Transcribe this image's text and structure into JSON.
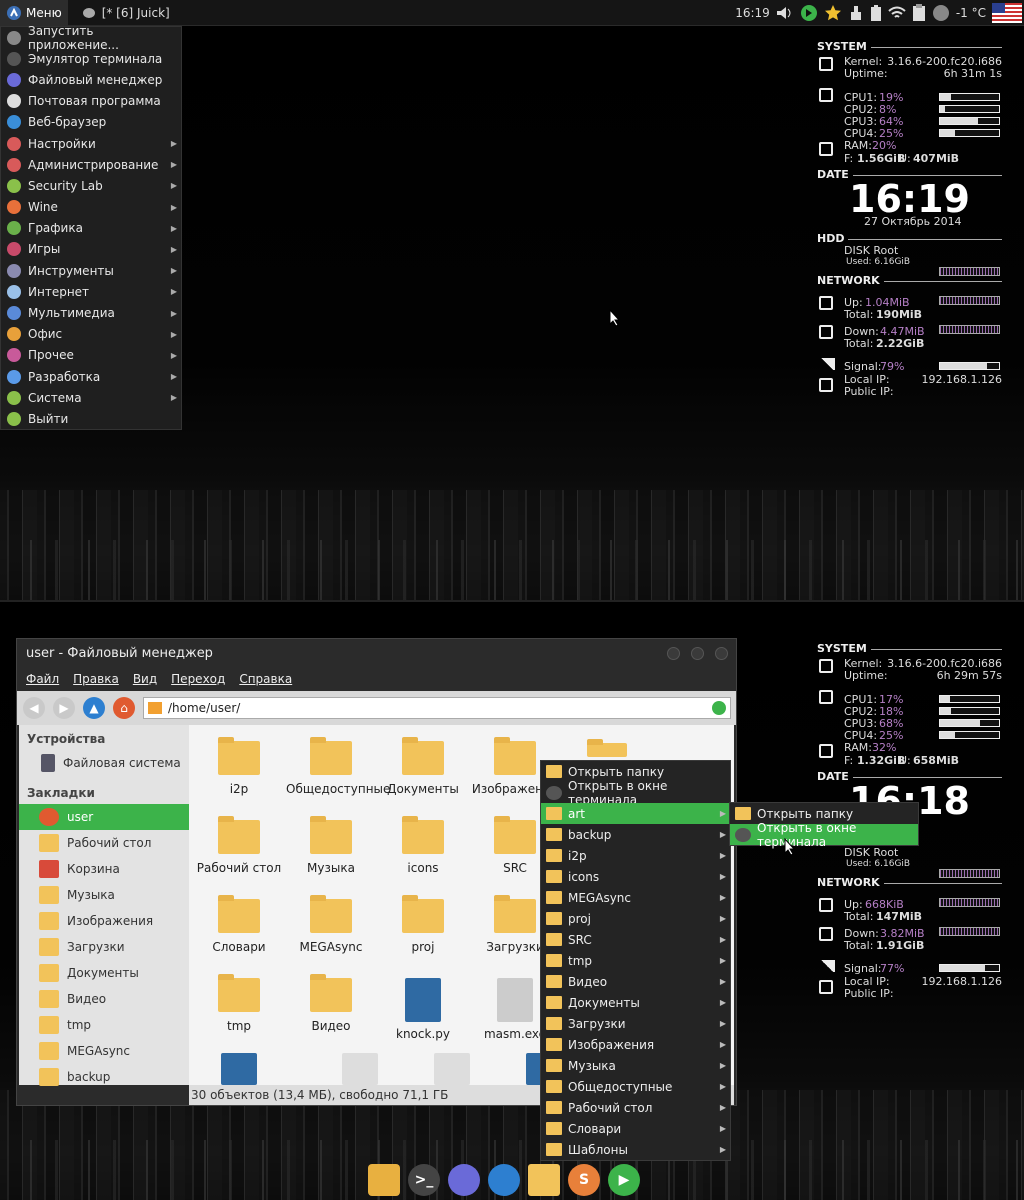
{
  "top_panel": {
    "menu_label": "Меню",
    "taskbar_item": "[* [6] Juick]",
    "clock": "16:19",
    "weather": "-1 °C"
  },
  "app_menu": {
    "items": [
      {
        "label": "Запустить приложение...",
        "submenu": false,
        "color": "#888888"
      },
      {
        "label": "Эмулятор терминала",
        "submenu": false,
        "color": "#555555"
      },
      {
        "label": "Файловый менеджер",
        "submenu": false,
        "color": "#6a6ad8"
      },
      {
        "label": "Почтовая программа",
        "submenu": false,
        "color": "#dddddd"
      },
      {
        "label": "Веб-браузер",
        "submenu": false,
        "color": "#3a8ed8"
      },
      {
        "label": "Настройки",
        "submenu": true,
        "color": "#d85a5a"
      },
      {
        "label": "Администрирование",
        "submenu": true,
        "color": "#d85a5a"
      },
      {
        "label": "Security Lab",
        "submenu": true,
        "color": "#8ac04a"
      },
      {
        "label": "Wine",
        "submenu": true,
        "color": "#e8703a"
      },
      {
        "label": "Графика",
        "submenu": true,
        "color": "#6ab04a"
      },
      {
        "label": "Игры",
        "submenu": true,
        "color": "#c84a6a"
      },
      {
        "label": "Инструменты",
        "submenu": true,
        "color": "#8a8ab0"
      },
      {
        "label": "Интернет",
        "submenu": true,
        "color": "#9ac0e8"
      },
      {
        "label": "Мультимедиа",
        "submenu": true,
        "color": "#5a8ad8"
      },
      {
        "label": "Офис",
        "submenu": true,
        "color": "#e8a03a"
      },
      {
        "label": "Прочее",
        "submenu": true,
        "color": "#c85a9a"
      },
      {
        "label": "Разработка",
        "submenu": true,
        "color": "#5a9ae8"
      },
      {
        "label": "Система",
        "submenu": true,
        "color": "#8ac04a"
      },
      {
        "label": "Выйти",
        "submenu": false,
        "color": "#8ac04a"
      }
    ]
  },
  "conky_top": {
    "system_header": "SYSTEM",
    "kernel_label": "Kernel:",
    "kernel": "3.16.6-200.fc20.i686",
    "uptime_label": "Uptime:",
    "uptime": "6h 31m 1s",
    "cpus": [
      {
        "label": "CPU1:",
        "value": "19%",
        "fraction": 0.19
      },
      {
        "label": "CPU2:",
        "value": "8%",
        "fraction": 0.08
      },
      {
        "label": "CPU3:",
        "value": "64%",
        "fraction": 0.64
      },
      {
        "label": "CPU4:",
        "value": "25%",
        "fraction": 0.25
      }
    ],
    "ram_label": "RAM:",
    "ram": "20%",
    "free_label": "F:",
    "free": "1.56GiB",
    "used_label": "U:",
    "used": "407MiB",
    "date_header": "DATE",
    "time": "16:19",
    "date": "27 Октябрь 2014",
    "hdd_header": "HDD",
    "disk_label": "DISK Root",
    "disk_used": "Used: 6.16GiB",
    "network_header": "NETWORK",
    "up_label": "Up:",
    "up": "1.04MiB",
    "up_total_label": "Total:",
    "up_total": "190MiB",
    "down_label": "Down:",
    "down": "4.47MiB",
    "down_total_label": "Total:",
    "down_total": "2.22GiB",
    "signal_label": "Signal:",
    "signal": "79%",
    "signal_fraction": 0.79,
    "local_ip_label": "Local IP:",
    "local_ip": "192.168.1.126",
    "public_ip_label": "Public IP:"
  },
  "conky_bottom": {
    "system_header": "SYSTEM",
    "kernel_label": "Kernel:",
    "kernel": "3.16.6-200.fc20.i686",
    "uptime_label": "Uptime:",
    "uptime": "6h 29m 57s",
    "cpus": [
      {
        "label": "CPU1:",
        "value": "17%",
        "fraction": 0.17
      },
      {
        "label": "CPU2:",
        "value": "18%",
        "fraction": 0.18
      },
      {
        "label": "CPU3:",
        "value": "68%",
        "fraction": 0.68
      },
      {
        "label": "CPU4:",
        "value": "25%",
        "fraction": 0.25
      }
    ],
    "ram_label": "RAM:",
    "ram": "32%",
    "free_label": "F:",
    "free": "1.32GiB",
    "used_label": "U:",
    "used": "658MiB",
    "date_header": "DATE",
    "time": "16:18",
    "date": "2014",
    "disk_label": "DISK Root",
    "disk_used": "Used: 6.16GiB",
    "network_header": "NETWORK",
    "up_label": "Up:",
    "up": "668KiB",
    "up_total_label": "Total:",
    "up_total": "147MiB",
    "down_label": "Down:",
    "down": "3.82MiB",
    "down_total_label": "Total:",
    "down_total": "1.91GiB",
    "signal_label": "Signal:",
    "signal": "77%",
    "signal_fraction": 0.77,
    "local_ip_label": "Local IP:",
    "local_ip": "192.168.1.126",
    "public_ip_label": "Public IP:"
  },
  "file_manager": {
    "title": "user - Файловый менеджер",
    "menu": [
      "Файл",
      "Правка",
      "Вид",
      "Переход",
      "Справка"
    ],
    "path": "/home/user/",
    "sidebar": {
      "devices_header": "Устройства",
      "devices": [
        "Файловая система"
      ],
      "bookmarks_header": "Закладки",
      "bookmarks": [
        "user",
        "Рабочий стол",
        "Корзина",
        "Музыка",
        "Изображения",
        "Загрузки",
        "Документы",
        "Видео",
        "tmp",
        "MEGAsync",
        "backup"
      ]
    },
    "files": [
      [
        "i2p",
        "Общедоступные",
        "Документы",
        "Изображения"
      ],
      [
        "Рабочий стол",
        "Музыка",
        "icons",
        "SRC"
      ],
      [
        "Словари",
        "MEGAsync",
        "proj",
        "Загрузки"
      ],
      [
        "tmp",
        "Видео",
        "knock.py",
        "masm.exe"
      ]
    ],
    "status": "30 объектов (13,4 МБ), свободно 71,1 ГБ"
  },
  "context_menu": {
    "items": [
      "Открыть папку",
      "Открыть в окне терминала",
      "art",
      "backup",
      "i2p",
      "icons",
      "MEGAsync",
      "proj",
      "SRC",
      "tmp",
      "Видео",
      "Документы",
      "Загрузки",
      "Изображения",
      "Музыка",
      "Общедоступные",
      "Рабочий стол",
      "Словари",
      "Шаблоны"
    ],
    "selected": "art"
  },
  "context_submenu": {
    "items": [
      "Открыть папку",
      "Открыть в окне терминала"
    ],
    "selected": "Открыть в окне терминала"
  }
}
